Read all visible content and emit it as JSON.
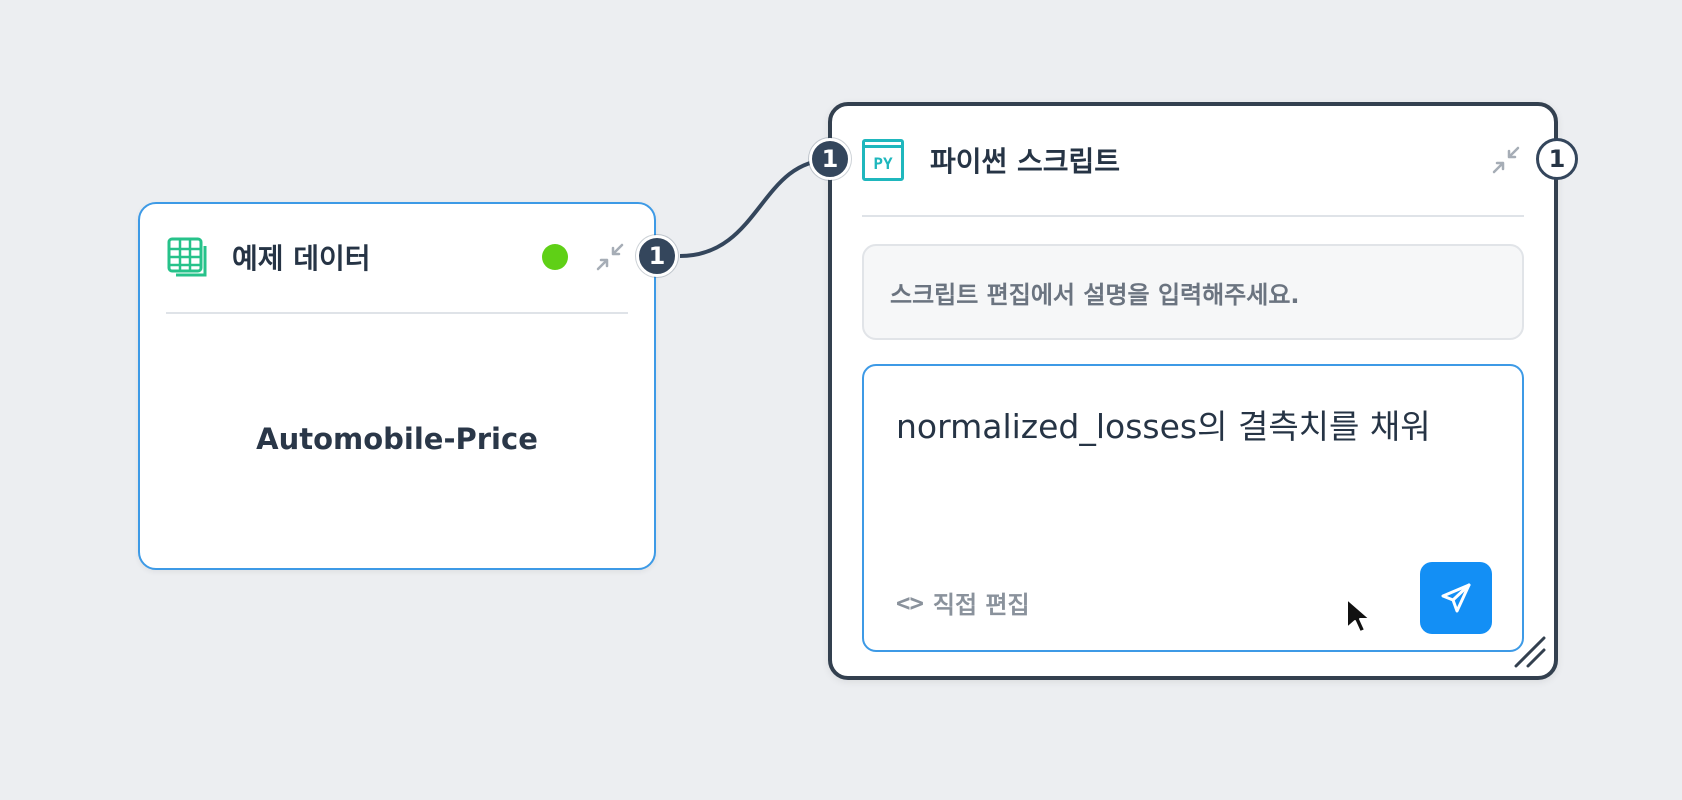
{
  "data_node": {
    "title": "예제 데이터",
    "icon": "table-icon",
    "status_color": "#5fd016",
    "dataset_name": "Automobile-Price",
    "output_port_label": "1"
  },
  "python_node": {
    "title": "파이썬 스크립트",
    "icon_text": "PY",
    "input_port_label": "1",
    "output_port_label": "1",
    "description_placeholder": "스크립트 편집에서 설명을 입력해주세요.",
    "prompt_text": "normalized_losses의 결측치를 채워",
    "edit_link_icon": "<>",
    "edit_link_label": "직접 편집",
    "send_icon": "paper-plane-icon"
  },
  "colors": {
    "background": "#eceef1",
    "accent_blue": "#3d9ae6",
    "send_button": "#138ff5",
    "node_dark_border": "#33404f",
    "py_icon": "#1fb7bd",
    "status_green": "#5fd016"
  }
}
